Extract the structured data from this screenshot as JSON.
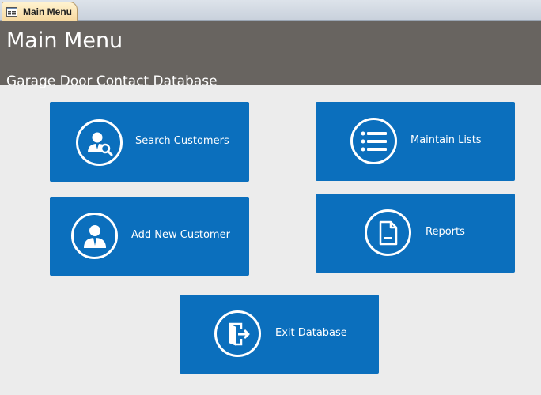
{
  "tab": {
    "label": "Main Menu",
    "icon": "form-icon"
  },
  "header": {
    "title": "Main Menu",
    "subtitle": "Garage Door Contact Database"
  },
  "tiles": [
    {
      "label": "Search Customers",
      "icon": "search-customer-icon"
    },
    {
      "label": "Maintain Lists",
      "icon": "list-icon"
    },
    {
      "label": "Add New Customer",
      "icon": "add-customer-icon"
    },
    {
      "label": "Reports",
      "icon": "report-document-icon"
    },
    {
      "label": "Exit Database",
      "icon": "exit-door-icon"
    }
  ],
  "colors": {
    "header_bg": "#686460",
    "tile_bg": "#0b6fbd",
    "page_bg": "#ececec"
  }
}
